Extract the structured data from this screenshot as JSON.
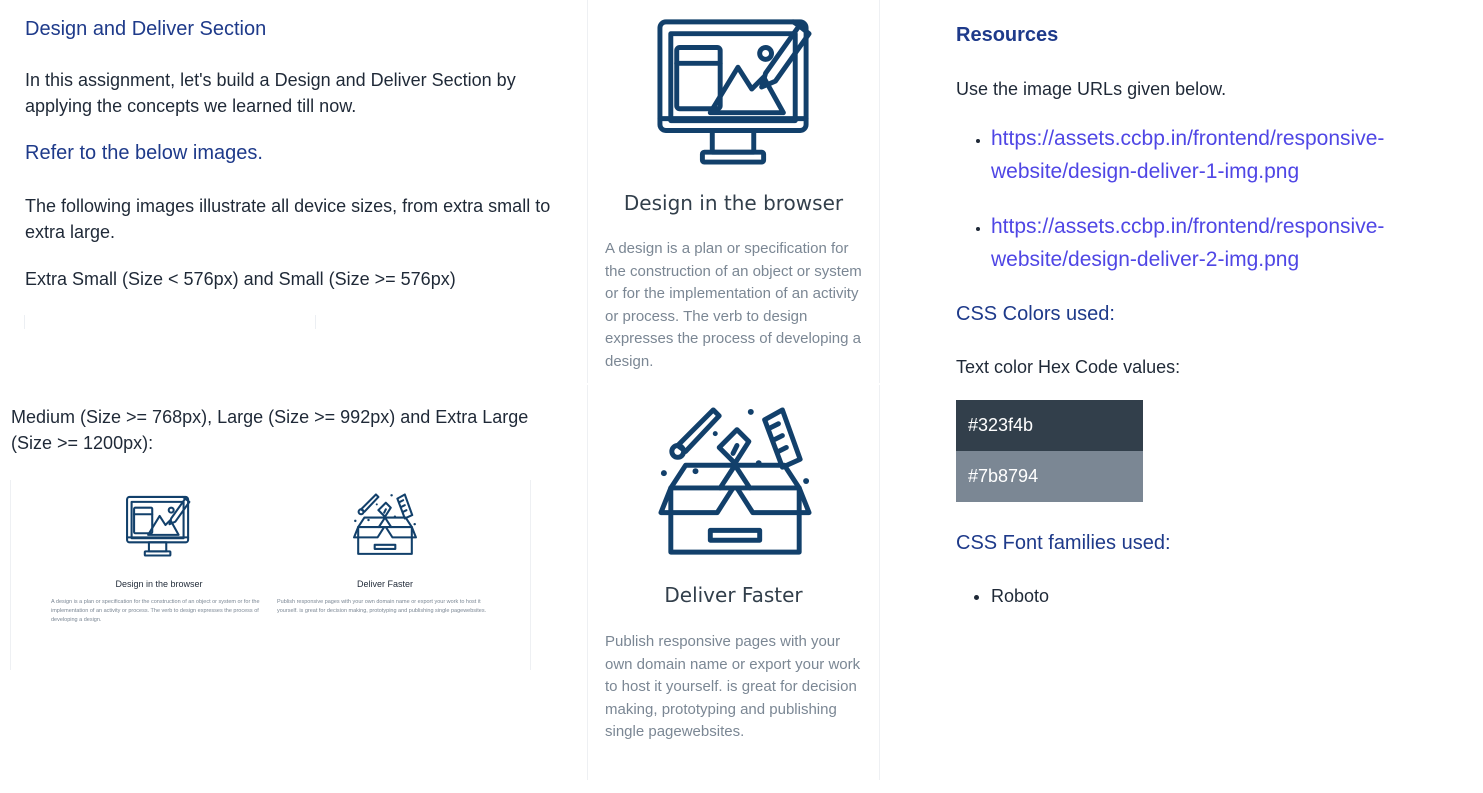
{
  "left": {
    "title": "Design and Deliver Section",
    "intro": "In this assignment, let's build a Design and Deliver Section by applying the concepts we learned till now.",
    "refer_heading": "Refer to the below images.",
    "illustrate_text": "The following images illustrate all device sizes, from extra small to extra large.",
    "xs_label": "Extra Small (Size < 576px) and Small (Size >= 576px)",
    "md_label": "Medium (Size >= 768px), Large (Size >= 992px) and Extra Large (Size >= 1200px):"
  },
  "cards": [
    {
      "title": "Design in the browser",
      "description": "A design is a plan or specification for the construction of an object or system or for the implementation of an activity or process. The verb to design expresses the process of developing a design.",
      "icon": "monitor-design-icon"
    },
    {
      "title": "Deliver Faster",
      "description": "Publish responsive pages with your own domain name or export your work to host it yourself. is great for decision making, prototyping and publishing single pagewebsites.",
      "icon": "delivery-box-icon"
    }
  ],
  "resources": {
    "title": "Resources",
    "description": "Use the image URLs given below.",
    "urls": [
      "https://assets.ccbp.in/frontend/responsive-website/design-deliver-1-img.png",
      "https://assets.ccbp.in/frontend/responsive-website/design-deliver-2-img.png"
    ]
  },
  "colors": {
    "title": "CSS Colors used:",
    "label": "Text color Hex Code values:",
    "swatches": [
      "#323f4b",
      "#7b8794"
    ]
  },
  "fonts": {
    "title": "CSS Font families used:",
    "items": [
      "Roboto"
    ]
  }
}
